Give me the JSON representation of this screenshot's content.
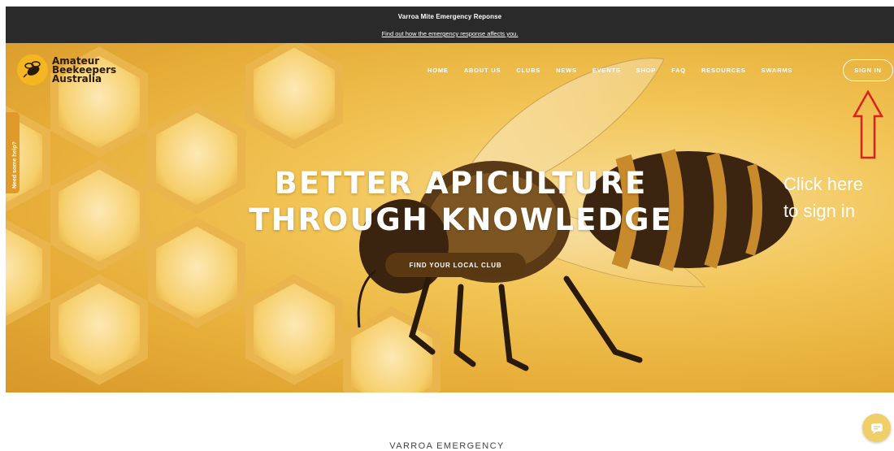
{
  "announcement": {
    "title": "Varroa Mite Emergency Reponse",
    "link": "Find out how the emergency response affects you."
  },
  "logo": {
    "line1": "Amateur",
    "line2": "Beekeepers",
    "line3": "Australia",
    "icon": "bee-icon"
  },
  "nav": {
    "items": [
      "HOME",
      "ABOUT US",
      "CLUBS",
      "NEWS",
      "EVENTS",
      "SHOP",
      "FAQ",
      "RESOURCES",
      "SWARMS"
    ],
    "sign_in": "SIGN IN"
  },
  "side_tab": {
    "label": "Need some help?"
  },
  "hero": {
    "line1": "BETTER APICULTURE",
    "line2": "THROUGH KNOWLEDGE",
    "cta": "FIND YOUR LOCAL CLUB"
  },
  "annotation": {
    "line1": "Click here",
    "line2": "to sign in",
    "color": "#e02020"
  },
  "section": {
    "heading": "VARROA EMERGENCY"
  },
  "chat": {
    "icon": "chat-icon"
  },
  "colors": {
    "announce_bg": "#2a2a2a",
    "brand_yellow": "#f4b71f",
    "cta_brown": "#5a3811"
  }
}
